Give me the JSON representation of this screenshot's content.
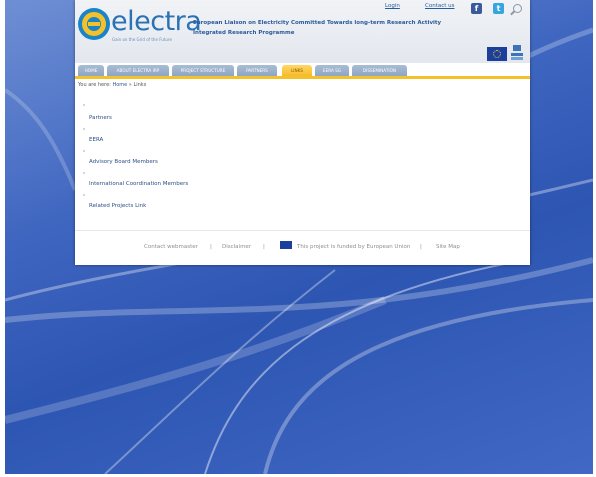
{
  "header": {
    "logo_text": "electra",
    "logo_tagline": "Gain on the Grid of the Future",
    "tagline_line1": "European Liaison on Electricity Committed Towards long-term Research Activity",
    "tagline_line2": "Integrated Research Programme",
    "login_label": "Login",
    "contact_label": "Contact us"
  },
  "nav": {
    "tabs": [
      {
        "label": "HOME"
      },
      {
        "label": "ABOUT ELECTRA IRP"
      },
      {
        "label": "PROJECT STRUCTURE"
      },
      {
        "label": "PARTNERS"
      },
      {
        "label": "LINKS",
        "active": true
      },
      {
        "label": "EERA SG"
      },
      {
        "label": "DISSEMINATION"
      }
    ]
  },
  "breadcrumb": {
    "prefix": "You are here:",
    "home": "Home",
    "sep": "»",
    "current": "Links"
  },
  "links": [
    {
      "label": "Partners"
    },
    {
      "label": "EERA"
    },
    {
      "label": "Advisory Board Members"
    },
    {
      "label": "International Coordination Members"
    },
    {
      "label": "Related Projects Link"
    }
  ],
  "footer": {
    "contact_webmaster": "Contact webmaster",
    "sep": "|",
    "disclaimer": "Disclaimer",
    "funded_text": "This project is funded by European Union",
    "site_map": "Site Map"
  },
  "colors": {
    "accent": "#f4c12a",
    "brand_blue": "#2a72b4",
    "nav_tab": "#9db2cd",
    "background_blue": "#3f66c0"
  },
  "icons": [
    "facebook-icon",
    "twitter-icon",
    "search-icon",
    "eu-flag-icon",
    "fp7-icon"
  ]
}
